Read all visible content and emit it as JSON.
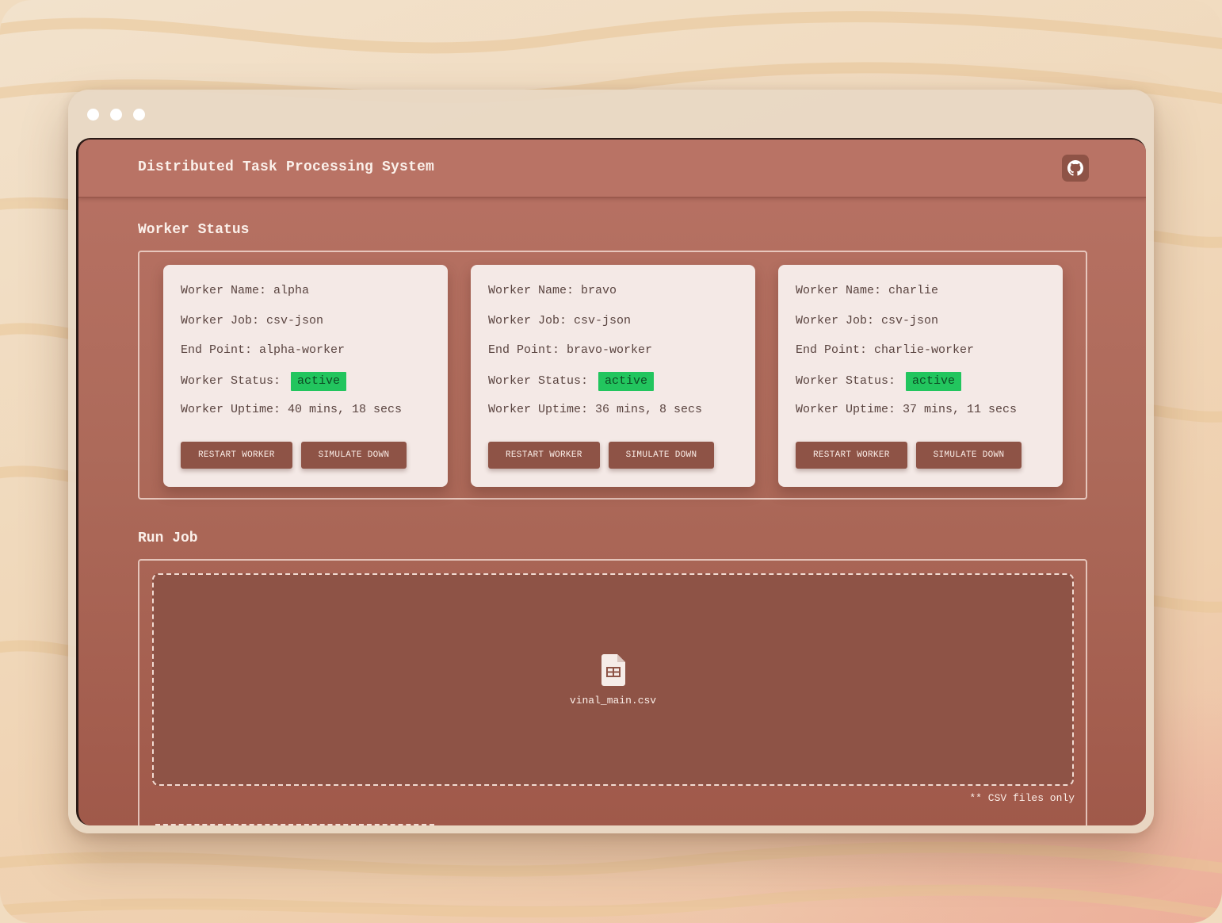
{
  "app": {
    "title": "Distributed Task Processing System"
  },
  "header": {
    "github_icon": "github-icon"
  },
  "worker_section": {
    "title": "Worker Status",
    "workers": [
      {
        "name_line": "Worker Name: alpha",
        "job_line": "Worker Job: csv-json",
        "endpoint_line": "End Point: alpha-worker",
        "status_label": "Worker Status:",
        "status": "active",
        "uptime_line": "Worker Uptime: 40 mins, 18 secs",
        "restart_label": "RESTART WORKER",
        "simulate_label": "SIMULATE DOWN"
      },
      {
        "name_line": "Worker Name: bravo",
        "job_line": "Worker Job: csv-json",
        "endpoint_line": "End Point: bravo-worker",
        "status_label": "Worker Status:",
        "status": "active",
        "uptime_line": "Worker Uptime: 36 mins, 8 secs",
        "restart_label": "RESTART WORKER",
        "simulate_label": "SIMULATE DOWN"
      },
      {
        "name_line": "Worker Name: charlie",
        "job_line": "Worker Job: csv-json",
        "endpoint_line": "End Point: charlie-worker",
        "status_label": "Worker Status:",
        "status": "active",
        "uptime_line": "Worker Uptime: 37 mins, 11 secs",
        "restart_label": "RESTART WORKER",
        "simulate_label": "SIMULATE DOWN"
      }
    ]
  },
  "run_job": {
    "title": "Run Job",
    "file_icon": "spreadsheet-file-icon",
    "file_name": "vinal_main.csv",
    "hint": "** CSV files only"
  },
  "colors": {
    "accent": "#8e5346",
    "active_badge": "#22c55e",
    "card_bg": "#f4e9e6"
  }
}
